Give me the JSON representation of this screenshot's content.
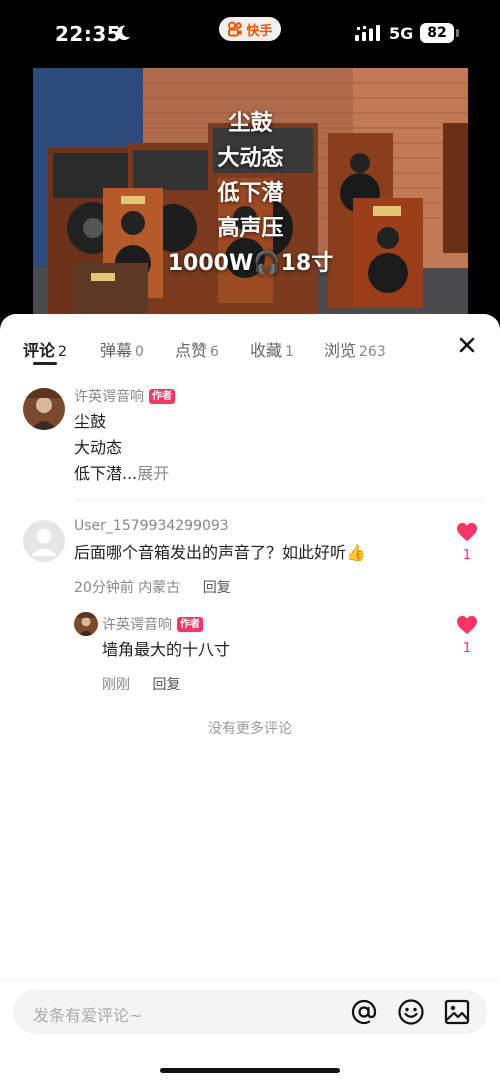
{
  "status_bar": {
    "time": "22:35",
    "network": "5G",
    "battery": "82",
    "app_name": "快手",
    "icons": [
      "moon-icon",
      "kuaishou-logo-icon",
      "signal-icon",
      "battery-icon"
    ]
  },
  "video": {
    "overlay_lines": [
      "尘鼓",
      "大动态",
      "低下潜",
      "高声压",
      "1000W🎧18寸"
    ]
  },
  "tabs": [
    {
      "label": "评论",
      "count": "2",
      "active": true
    },
    {
      "label": "弹幕",
      "count": "0"
    },
    {
      "label": "点赞",
      "count": "6"
    },
    {
      "label": "收藏",
      "count": "1"
    },
    {
      "label": "浏览",
      "count": "263"
    }
  ],
  "author_post": {
    "username": "许英谔音响",
    "badge": "作者",
    "lines": [
      "尘鼓",
      "大动态"
    ],
    "last_line": "低下潜...",
    "expand_label": "展开"
  },
  "comment": {
    "username": "User_1579934299093",
    "text": "后面哪个音箱发出的声音了？如此好听👍",
    "time": "20分钟前",
    "location": "内蒙古",
    "reply_label": "回复",
    "likes": "1"
  },
  "reply": {
    "username": "许英谔音响",
    "badge": "作者",
    "text": "墙角最大的十八寸",
    "time": "刚刚",
    "reply_label": "回复",
    "likes": "1"
  },
  "no_more_text": "没有更多评论",
  "input": {
    "placeholder": "发条有爱评论~"
  },
  "colors": {
    "accent": "#fe3666",
    "brand": "#ff5000",
    "text": "#222222",
    "muted": "#888888"
  }
}
